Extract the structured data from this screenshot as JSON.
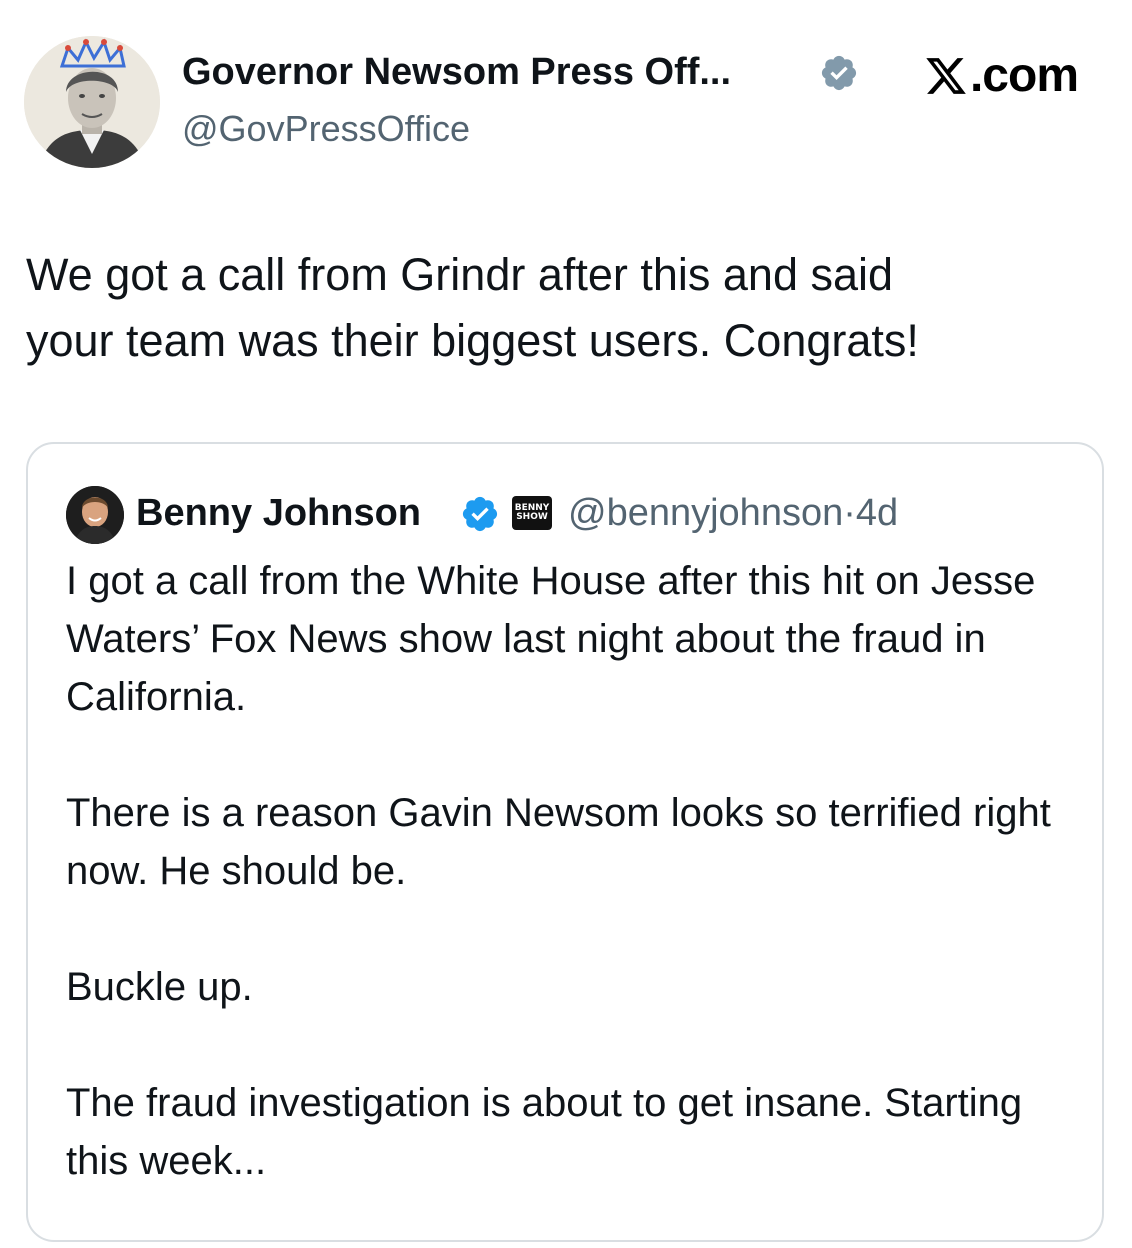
{
  "site": {
    "logo_text": ".com",
    "logo_icon": "x-logo-icon"
  },
  "tweet": {
    "author_name": "Governor Newsom Press Off...",
    "author_handle": "@GovPressOffice",
    "verified_color": "#829aab",
    "text": "We got a call from Grindr after this and said\nyour team was their biggest users. Congrats!"
  },
  "quoted_tweet": {
    "author_name": "Benny Johnson",
    "verified_color": "#1d9bf0",
    "affiliate_badge": "BENNY SHOW",
    "handle": "@bennyjohnson",
    "separator": "·",
    "time": "4d",
    "paragraphs": [
      "I got a call from the White House after this hit on Jesse Waters’ Fox News show last night about the fraud in California.",
      "There is a reason Gavin Newsom looks so terrified right now. He should be.",
      "Buckle up.",
      "The fraud investigation is about to get insane. Starting this week..."
    ]
  },
  "colors": {
    "text": "#0f1419",
    "secondary": "#536471",
    "border": "#d9dee2",
    "accent_blue": "#1d9bf0"
  }
}
